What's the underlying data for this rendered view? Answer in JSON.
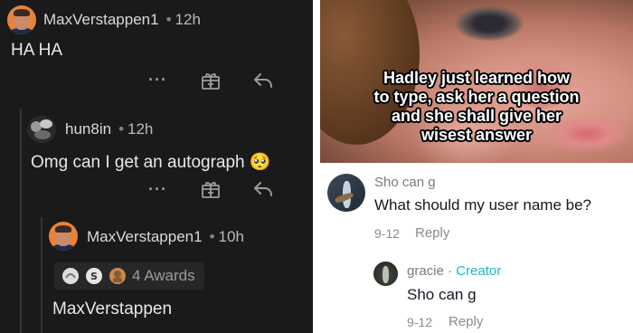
{
  "left": {
    "comment1": {
      "username": "MaxVerstappen1",
      "separator": "•",
      "time": "12h",
      "text": "HA HA",
      "more_icon": "more-dots-icon",
      "award_icon": "gift-icon",
      "reply_icon": "reply-arrow-icon"
    },
    "comment2": {
      "username": "hun8in",
      "separator": "•",
      "time": "12h",
      "text": "Omg can I get an autograph",
      "emoji": "🥺",
      "more_icon": "more-dots-icon",
      "award_icon": "gift-icon",
      "reply_icon": "reply-arrow-icon"
    },
    "comment3": {
      "username": "MaxVerstappen1",
      "separator": "•",
      "time": "10h",
      "awards_label": "4 Awards",
      "text": "MaxVerstappen"
    }
  },
  "right": {
    "video_caption": [
      "Hadley just learned how",
      "to type, ask her a question",
      "and she shall give her",
      "wisest answer"
    ],
    "comment1": {
      "username": "Sho can g",
      "text": "What should my user name be?",
      "date": "9-12",
      "reply_label": "Reply"
    },
    "comment2": {
      "username": "gracie",
      "separator": " · ",
      "badge": "Creator",
      "text": "Sho can g",
      "date": "9-12",
      "reply_label": "Reply"
    }
  },
  "colors": {
    "reddit_bg": "#1a1a1b",
    "tiktok_creator": "#20b7c7",
    "avatar_orange": "#e8843a"
  }
}
